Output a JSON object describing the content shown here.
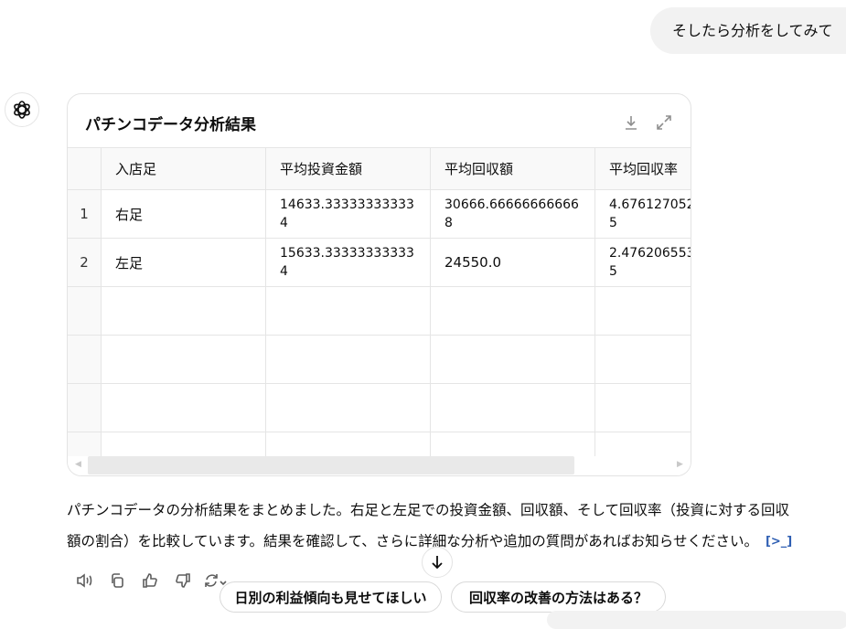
{
  "user_message": "そしたら分析をしてみて",
  "card": {
    "title": "パチンコデータ分析結果",
    "columns": [
      "入店足",
      "平均投資金額",
      "平均回収額",
      "平均回収率"
    ],
    "rows": [
      {
        "index": "1",
        "cells": [
          "右足",
          "14633.333333333334",
          "30666.666666666668",
          "4.6761270525"
        ]
      },
      {
        "index": "2",
        "cells": [
          "左足",
          "15633.333333333334",
          "24550.0",
          "2.4762065535"
        ]
      }
    ]
  },
  "response": {
    "line1": "パチンコデータの分析結果をまとめました。右足と左足での投資金額、回収額、そして回収率（投資に対する回収",
    "line2": "額の割合）を比較しています。結果を確認して、さらに詳細な分析や追加の質問があればお知らせください。",
    "code_icon": "[>_]"
  },
  "suggestions": [
    "日別の利益傾向も見せてほしい",
    "回収率の改善の方法はある？"
  ],
  "icons": [
    "chatgpt-logo-icon",
    "download-icon",
    "expand-icon",
    "speaker-icon",
    "copy-icon",
    "thumbs-up-icon",
    "thumbs-down-icon",
    "regenerate-icon",
    "arrow-down-icon"
  ]
}
